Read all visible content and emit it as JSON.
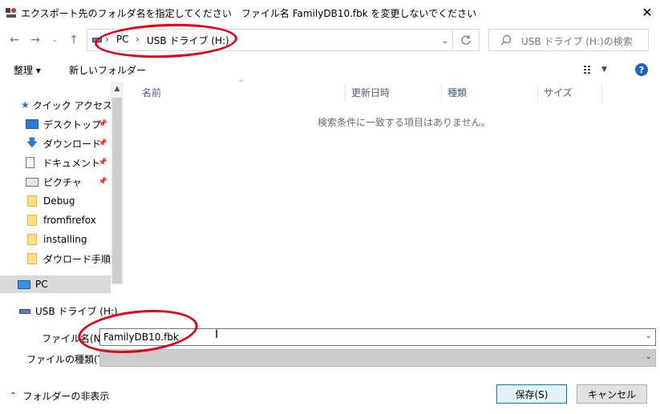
{
  "window": {
    "title": "エクスポート先のフォルダ名を指定してください　ファイル名 FamilyDB10.fbk を変更しないでください",
    "close": "✕"
  },
  "address": {
    "items": [
      "PC",
      "USB ドライブ (H:)"
    ],
    "separator": "›"
  },
  "search": {
    "placeholder": "USB ドライブ (H:)の検索"
  },
  "toolbar": {
    "organize": "整理 ▾",
    "new_folder": "新しいフォルダー"
  },
  "nav": {
    "quick_access": "クイック アクセス",
    "items": [
      {
        "label": "デスクトップ",
        "pinned": true
      },
      {
        "label": "ダウンロード",
        "pinned": true
      },
      {
        "label": "ドキュメント",
        "pinned": true
      },
      {
        "label": "ピクチャ",
        "pinned": true
      },
      {
        "label": "Debug",
        "pinned": false
      },
      {
        "label": "fromfirefox",
        "pinned": false
      },
      {
        "label": "installing",
        "pinned": false
      },
      {
        "label": "ダウロード手順",
        "pinned": false
      }
    ],
    "pc": "PC",
    "usb": "USB ドライブ (H:)"
  },
  "columns": [
    "名前",
    "更新日時",
    "種類",
    "サイズ"
  ],
  "empty_message": "検索条件に一致する項目はありません。",
  "form": {
    "filename_label": "ファイル名(N):",
    "filename_value": "FamilyDB10.fbk",
    "filetype_label": "ファイルの種類(T):",
    "filetype_value": ""
  },
  "footer": {
    "hide_folders": "フォルダーの非表示",
    "save": "保存(S)",
    "cancel": "キャンセル"
  },
  "colors": {
    "annotation": "#e60012",
    "help": "#1e63c8",
    "selection": "#d9d9d9"
  }
}
